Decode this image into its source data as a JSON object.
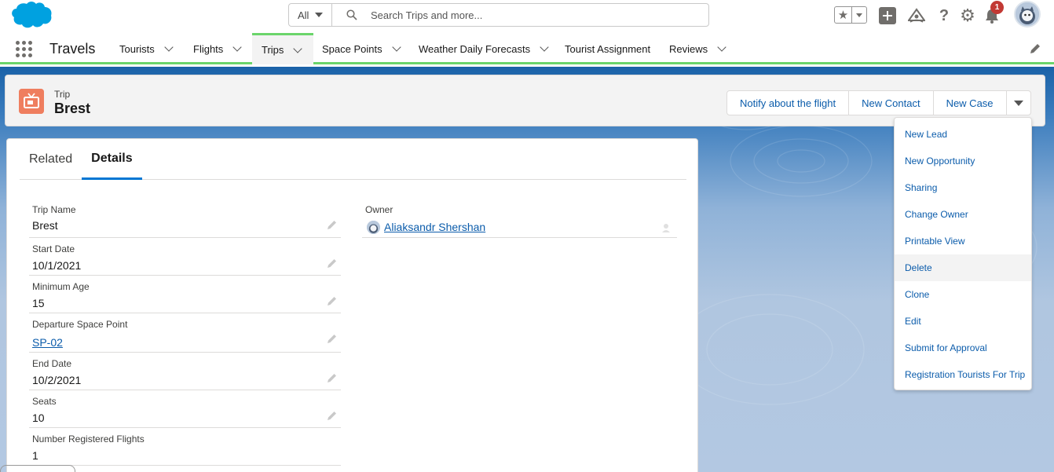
{
  "search": {
    "scope": "All",
    "placeholder": "Search Trips and more..."
  },
  "notifications": {
    "count": "1"
  },
  "nav": {
    "app_name": "Travels",
    "items": [
      {
        "label": "Tourists",
        "has_menu": true
      },
      {
        "label": "Flights",
        "has_menu": true
      },
      {
        "label": "Trips",
        "has_menu": true,
        "active": true
      },
      {
        "label": "Space Points",
        "has_menu": true
      },
      {
        "label": "Weather Daily Forecasts",
        "has_menu": true
      },
      {
        "label": "Tourist Assignment",
        "has_menu": false
      },
      {
        "label": "Reviews",
        "has_menu": true
      }
    ]
  },
  "record": {
    "object_label": "Trip",
    "title": "Brest",
    "actions": [
      "Notify about the flight",
      "New Contact",
      "New Case"
    ]
  },
  "more_actions_menu": [
    "New Lead",
    "New Opportunity",
    "Sharing",
    "Change Owner",
    "Printable View",
    "Delete",
    "Clone",
    "Edit",
    "Submit for Approval",
    "Registration Tourists For Trip"
  ],
  "tabs": [
    {
      "label": "Related"
    },
    {
      "label": "Details",
      "active": true
    }
  ],
  "fields": [
    {
      "label": "Trip Name",
      "value": "Brest"
    },
    {
      "label": "Start Date",
      "value": "10/1/2021"
    },
    {
      "label": "Minimum Age",
      "value": "15"
    },
    {
      "label": "Departure Space Point",
      "value": "SP-02",
      "link": true
    },
    {
      "label": "End Date",
      "value": "10/2/2021"
    },
    {
      "label": "Seats",
      "value": "10"
    },
    {
      "label": "Number Registered Flights",
      "value": "1"
    }
  ],
  "owner": {
    "label": "Owner",
    "value": "Aliaksandr Shershan"
  },
  "colors": {
    "accent": "#0176d3",
    "link": "#0b5cab",
    "nav_active": "#6bd56b",
    "record_icon": "#ef7e5f",
    "badge": "#c23934"
  }
}
